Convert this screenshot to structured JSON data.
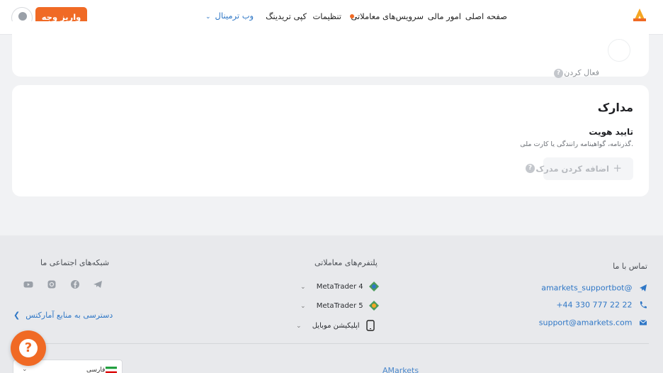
{
  "header": {
    "nav": {
      "home": "صفحه اصلی",
      "finance": "امور مالی",
      "trading_services": "سرویس‌های معاملاتی",
      "settings": "تنظیمات",
      "copy_trading": "کپی تریدینگ",
      "web_terminal": "وب ترمینال"
    },
    "deposit_label": "واریز وجه",
    "accent_color": "#f06a25"
  },
  "top_card": {
    "activate_label": "فعال کردن"
  },
  "documents": {
    "title": "مدارک",
    "verify_title": "تایید هویت",
    "verify_desc": "گذرنامه، گواهینامه رانندگی یا کارت ملی.",
    "add_button": "اضافه کردن مدرک"
  },
  "footer": {
    "contact_title": "تماس با ما",
    "telegram": "amarkets_supportbot@",
    "phone": "+44 330 777 22 22",
    "email": "support@amarkets.com",
    "platforms_title": "پلتفرم‌های معاملاتی",
    "platforms": [
      "MetaTrader 4",
      "MetaTrader 5",
      "اپلیکیشن موبایل"
    ],
    "social_title": "شبکه‌های اجتماعی ما",
    "social_icons": [
      "telegram-icon",
      "facebook-icon",
      "instagram-icon",
      "youtube-icon"
    ],
    "resources_link": "دسترسی به منابع آمارکتس",
    "language": "فارسی",
    "bottom_link": "AMarkets"
  }
}
